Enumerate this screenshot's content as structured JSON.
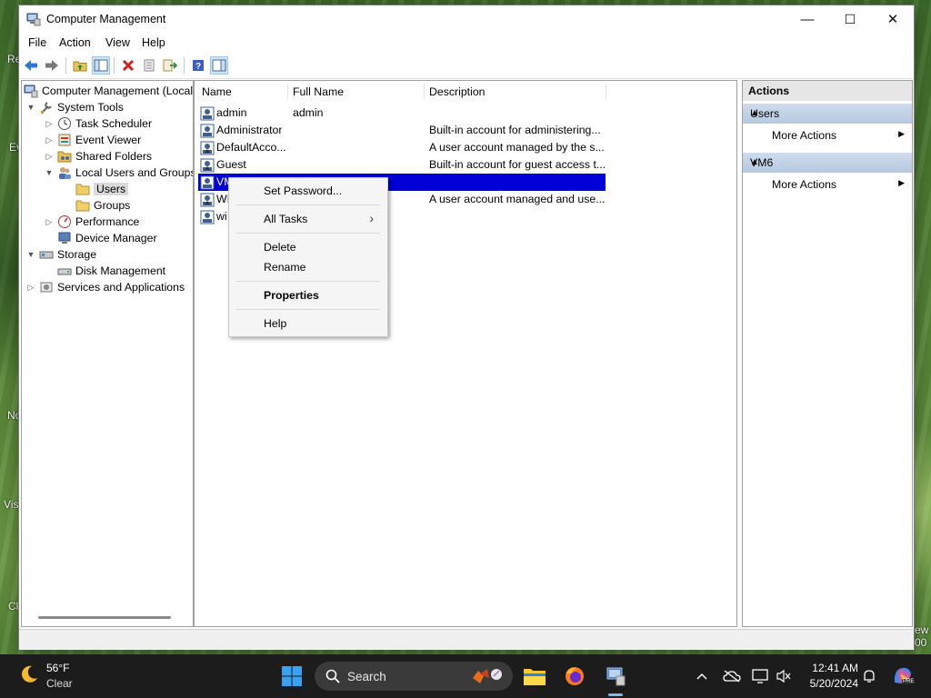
{
  "window": {
    "title": "Computer Management",
    "controls": {
      "minimize": "—",
      "maximize": "☐",
      "close": "✕"
    }
  },
  "menu": [
    "File",
    "Action",
    "View",
    "Help"
  ],
  "tree": {
    "items": [
      {
        "label": "Computer Management (Local",
        "icon": "computer-management-icon"
      },
      {
        "label": "System Tools",
        "icon": "system-tools-icon",
        "arrow": "expanded"
      },
      {
        "label": "Task Scheduler",
        "icon": "clock-icon",
        "arrow": "collapsed"
      },
      {
        "label": "Event Viewer",
        "icon": "event-viewer-icon",
        "arrow": "collapsed"
      },
      {
        "label": "Shared Folders",
        "icon": "shared-folder-icon",
        "arrow": "collapsed"
      },
      {
        "label": "Local Users and Groups",
        "icon": "users-icon",
        "arrow": "expanded"
      },
      {
        "label": "Users",
        "icon": "folder-icon",
        "selected": true
      },
      {
        "label": "Groups",
        "icon": "folder-icon"
      },
      {
        "label": "Performance",
        "icon": "performance-icon",
        "arrow": "collapsed"
      },
      {
        "label": "Device Manager",
        "icon": "device-manager-icon"
      },
      {
        "label": "Storage",
        "icon": "storage-icon",
        "arrow": "expanded"
      },
      {
        "label": "Disk Management",
        "icon": "disk-icon"
      },
      {
        "label": "Services and Applications",
        "icon": "services-icon",
        "arrow": "collapsed"
      }
    ]
  },
  "list": {
    "columns": [
      "Name",
      "Full Name",
      "Description"
    ],
    "rows": [
      {
        "name": "admin",
        "full_name": "admin",
        "description": ""
      },
      {
        "name": "Administrator",
        "full_name": "",
        "description": "Built-in account for administering..."
      },
      {
        "name": "DefaultAcco...",
        "full_name": "",
        "description": "A user account managed by the s..."
      },
      {
        "name": "Guest",
        "full_name": "",
        "description": "Built-in account for guest access t..."
      },
      {
        "name": "VM6",
        "full_name": "",
        "description": "",
        "selected": true
      },
      {
        "name": "WI",
        "full_name": "",
        "description": "A user account managed and use..."
      },
      {
        "name": "wi",
        "full_name": "",
        "description": ""
      }
    ]
  },
  "context_menu": {
    "items": [
      {
        "label": "Set Password..."
      },
      {
        "label": "All Tasks",
        "submenu": true
      },
      {
        "label": "Delete"
      },
      {
        "label": "Rename"
      },
      {
        "label": "Properties",
        "bold": true
      },
      {
        "label": "Help"
      }
    ],
    "submenu_arrow": "›"
  },
  "actions": {
    "title": "Actions",
    "sections": [
      {
        "title": "Users",
        "item": "More Actions"
      },
      {
        "title": "VM6",
        "item": "More Actions"
      }
    ]
  },
  "desktop_fragments": [
    "Re",
    "Ev",
    "No",
    "Vis",
    "Cl",
    "ew",
    "00"
  ],
  "taskbar": {
    "weather_temp": "56°F",
    "weather_desc": "Clear",
    "search_label": "Search",
    "time": "12:41 AM",
    "date": "5/20/2024",
    "copilot_badge": "PRE"
  },
  "colors": {
    "selection": "#0000d7",
    "actions_header": "#b6c9e1",
    "taskbar": "#1c1c1c"
  }
}
